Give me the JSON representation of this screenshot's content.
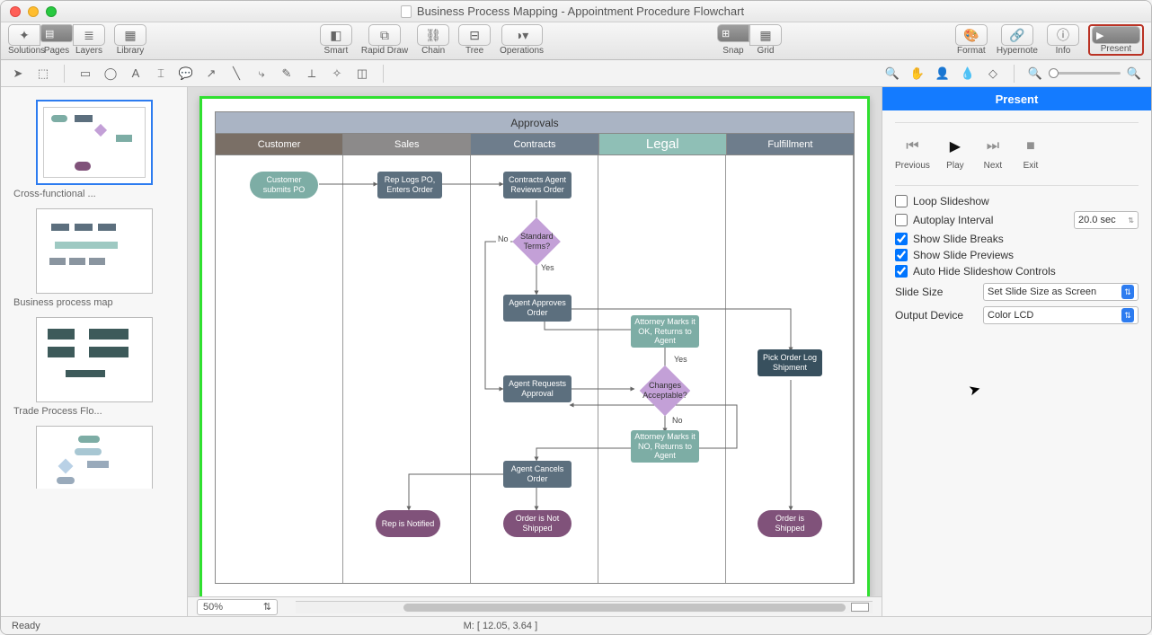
{
  "titlebar": {
    "title": "Business Process Mapping - Appointment Procedure Flowchart"
  },
  "toolbar": {
    "solutions": "Solutions",
    "pages": "Pages",
    "layers": "Layers",
    "library": "Library",
    "smart": "Smart",
    "rapid": "Rapid Draw",
    "chain": "Chain",
    "tree": "Tree",
    "operations": "Operations",
    "snap": "Snap",
    "grid": "Grid",
    "format": "Format",
    "hypernote": "Hypernote",
    "info": "Info",
    "present": "Present"
  },
  "sidebar": {
    "items": [
      {
        "label": "Cross-functional ..."
      },
      {
        "label": "Business process map"
      },
      {
        "label": "Trade Process Flo..."
      },
      {
        "label": ""
      }
    ]
  },
  "flowchart": {
    "title": "Approvals",
    "lanes": [
      "Customer",
      "Sales",
      "Contracts",
      "Legal",
      "Fulfillment"
    ],
    "nodes": {
      "n1": "Customer submits PO",
      "n2": "Rep Logs PO, Enters Order",
      "n3": "Contracts Agent Reviews Order",
      "n4": "Standard Terms?",
      "n5": "Agent Approves Order",
      "n6": "Agent Requests Approval",
      "n7": "Agent Cancels Order",
      "n8": "Attorney Marks it OK, Returns to Agent",
      "n9": "Changes Acceptable?",
      "n10": "Attorney Marks it NO, Returns to Agent",
      "n11": "Pick Order Log Shipment",
      "n12": "Rep is Notified",
      "n13": "Order is Not Shipped",
      "n14": "Order is Shipped"
    },
    "edge_labels": {
      "no": "No",
      "yes": "Yes"
    }
  },
  "zoom": {
    "value": "50%"
  },
  "status": {
    "ready": "Ready",
    "mouse": "M: [ 12.05, 3.64 ]"
  },
  "panel": {
    "title": "Present",
    "controls": {
      "previous": "Previous",
      "play": "Play",
      "next": "Next",
      "exit": "Exit"
    },
    "options": {
      "loop": "Loop Slideshow",
      "autoplay": "Autoplay Interval",
      "autoplay_val": "20.0 sec",
      "breaks": "Show Slide Breaks",
      "previews": "Show Slide Previews",
      "autohide": "Auto Hide Slideshow Controls",
      "slide_size_label": "Slide Size",
      "slide_size_val": "Set Slide Size as Screen",
      "output_label": "Output Device",
      "output_val": "Color LCD"
    }
  }
}
